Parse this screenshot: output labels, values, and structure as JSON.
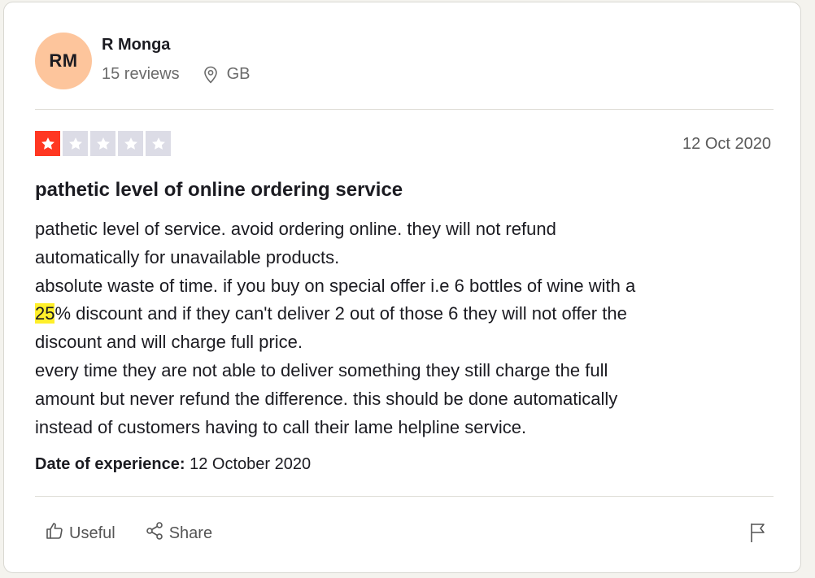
{
  "author": {
    "initials": "RM",
    "name": "R Monga",
    "reviews": "15 reviews",
    "location": "GB",
    "avatar_color": "#fdc59c"
  },
  "review": {
    "rating": 1,
    "max_rating": 5,
    "star_color": "#ff3722",
    "date": "12 Oct 2020",
    "title": "pathetic level of online ordering service",
    "body": {
      "line1": "pathetic level of service. avoid ordering online. they will not refund",
      "line2": "automatically for unavailable products.",
      "line3": "absolute waste of time. if you buy on special offer i.e 6 bottles of wine with a",
      "line4_highlight": "25",
      "line4_rest": "% discount and if they can't deliver 2 out of those 6 they will not offer the",
      "line5": "discount and will charge full price.",
      "line6": "every time they are not able to deliver something they still charge the full",
      "line7": "amount but never refund the difference. this should be done automatically",
      "line8": "instead of customers having to call their lame helpline service."
    },
    "experience_label": "Date of experience:",
    "experience_date": "12 October 2020"
  },
  "actions": {
    "useful_label": "Useful",
    "share_label": "Share",
    "icons": [
      "thumbs-up-icon",
      "share-icon",
      "flag-icon",
      "location-pin-icon",
      "star-icon"
    ]
  }
}
